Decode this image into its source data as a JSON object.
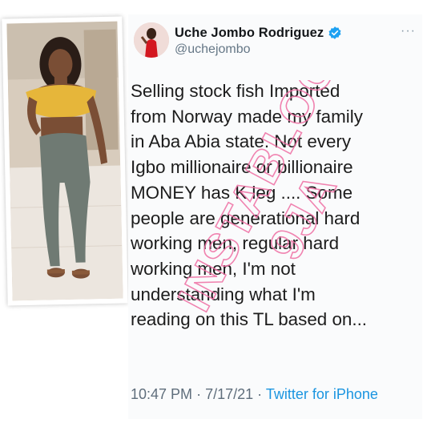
{
  "tweet": {
    "author": {
      "display_name": "Uche Jombo Rodriguez",
      "handle": "@uchejombo",
      "verified": true
    },
    "more_label": "···",
    "text_lines": [
      "Selling stock fish Imported",
      "from Norway made my family",
      "in Aba Abia state. Not every",
      "Igbo millionaire or billionaire",
      "MONEY has K leg .... Some",
      "people are generational hard",
      "working men, regular hard",
      "working men, I'm not",
      "understanding what I'm",
      "reading on this TL based on..."
    ],
    "time": "10:47 PM",
    "separator": "·",
    "date": "7/17/21",
    "source": "Twitter for iPhone"
  },
  "watermark": {
    "lines": [
      "INSTABLOG",
      "9JA"
    ]
  },
  "colors": {
    "text": "#1c1c1c",
    "meta_gray": "#5f6e7c",
    "link_blue": "#1b95e0",
    "verified_blue": "#1da1f2",
    "watermark_pink": "#ef6fa3",
    "top_yellow": "#e6b63a",
    "leggings_gray": "#6f7a73"
  },
  "icons": {
    "verified": "verified-badge-icon",
    "more": "more-options-icon"
  }
}
